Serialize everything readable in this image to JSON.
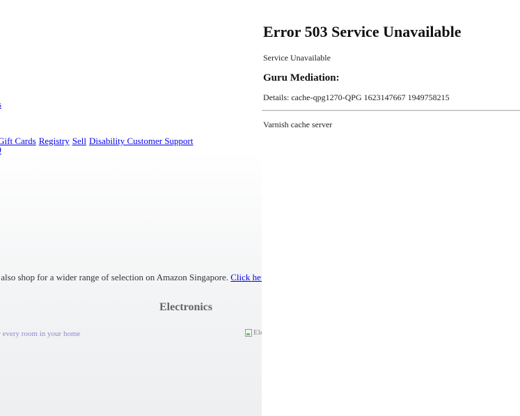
{
  "left_page": {
    "orders_link": "rders",
    "nav_links": [
      "ice",
      "Gift Cards",
      "Registry",
      "Sell",
      "Disability Customer Support"
    ],
    "nav_second_line": "0-19",
    "shop_text": "can also shop for a wider range of selection on Amazon Singapore.",
    "shop_link": "Click here t",
    "category_heading": "Electronics",
    "room_text": "for every room in your home",
    "broken_image_alt": "Ele"
  },
  "error_page": {
    "title": "Error 503 Service Unavailable",
    "subtitle": "Service Unavailable",
    "guru_heading": "Guru Mediation:",
    "details": "Details: cache-qpg1270-QPG 1623147667 1949758215",
    "footer": "Varnish cache server"
  }
}
